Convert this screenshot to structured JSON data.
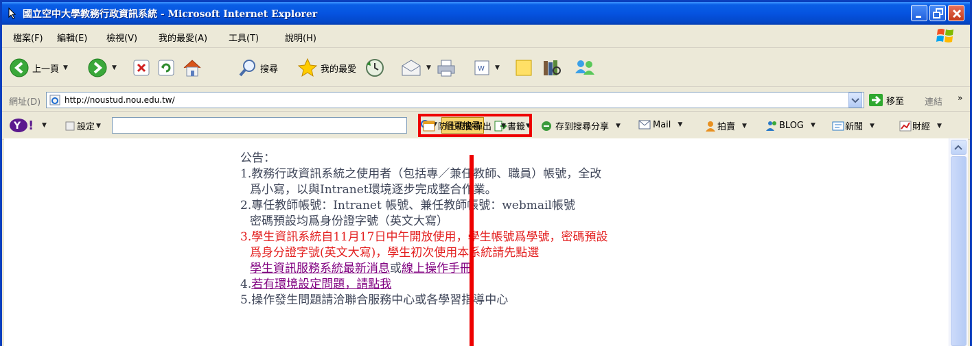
{
  "window": {
    "title": "國立空中大學教務行政資訊系統 - Microsoft Internet Explorer"
  },
  "menu": [
    "檔案(F)",
    "編輯(E)",
    "檢視(V)",
    "我的最愛(A)",
    "工具(T)",
    "說明(H)"
  ],
  "toolbar": {
    "back_label": "上一頁",
    "search_label": "搜尋",
    "favorites_label": "我的最愛"
  },
  "address": {
    "label": "網址(D)",
    "url": "http://noustud.nou.edu.tw/",
    "go_label": "移至",
    "links_label": "連結"
  },
  "yahoo": {
    "settings_label": "設定",
    "web_search_label": "網頁搜尋",
    "bookmarks_label": "書籤",
    "popup_blocker_label": "防止視窗彈出",
    "share_label": "存到搜尋分享",
    "mail_label": "Mail",
    "auction_label": "拍賣",
    "blog_label": "BLOG",
    "news_label": "新聞",
    "finance_label": "財經"
  },
  "notice": {
    "heading": "公告：",
    "item1_line1": "1.教務行政資訊系統之使用者（包括專／兼任教師、職員）帳號，全改",
    "item1_line2": "爲小寫，以與Intranet環境逐步完成整合作業。",
    "item2_line1": "2.專任教師帳號：Intranet 帳號、兼任教師帳號：webmail帳號",
    "item2_line2": "密碼預設均爲身份證字號（英文大寫）",
    "item3_line1": "3.學生資訊系統自11月17日中午開放使用，學生帳號爲學號，密碼預設",
    "item3_line2": "爲身分證字號(英文大寫)，學生初次使用本系統請先點選",
    "item3_link1": "學生資訊服務系統最新消息",
    "item3_or": "或",
    "item3_link2": "線上操作手冊",
    "item4_prefix": "4.",
    "item4_link": "若有環境設定問題，請點我",
    "item5": "5.操作發生問題請洽聯合服務中心或各學習指導中心"
  },
  "colors": {
    "title_bar": "#0553e0",
    "highlight": "#ee0000",
    "notice_text": "#40475a",
    "notice_red": "#e32020",
    "link": "#800080"
  }
}
